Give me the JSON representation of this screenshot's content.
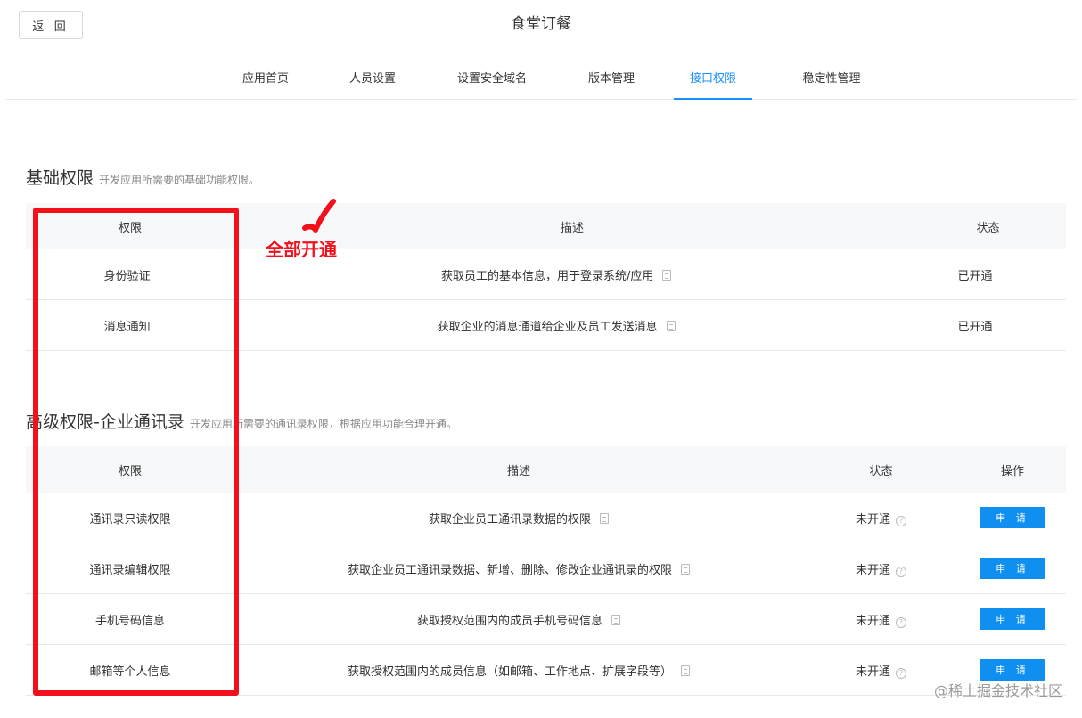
{
  "header": {
    "back_label": "返 回",
    "title": "食堂订餐"
  },
  "tabs": [
    {
      "label": "应用首页",
      "active": false
    },
    {
      "label": "人员设置",
      "active": false
    },
    {
      "label": "设置安全域名",
      "active": false
    },
    {
      "label": "版本管理",
      "active": false
    },
    {
      "label": "接口权限",
      "active": true
    },
    {
      "label": "稳定性管理",
      "active": false
    }
  ],
  "basic": {
    "title": "基础权限",
    "desc": "开发应用所需要的基础功能权限。",
    "columns": {
      "permission": "权限",
      "description": "描述",
      "status": "状态"
    },
    "rows": [
      {
        "name": "身份验证",
        "description": "获取员工的基本信息，用于登录系统/应用",
        "status": "已开通"
      },
      {
        "name": "消息通知",
        "description": "获取企业的消息通道给企业及员工发送消息",
        "status": "已开通"
      }
    ]
  },
  "advanced": {
    "title": "高级权限-企业通讯录",
    "desc": "开发应用所需要的通讯录权限，根据应用功能合理开通。",
    "columns": {
      "permission": "权限",
      "description": "描述",
      "status": "状态",
      "action": "操作"
    },
    "rows": [
      {
        "name": "通讯录只读权限",
        "description": "获取企业员工通讯录数据的权限",
        "status": "未开通",
        "action": "申 请"
      },
      {
        "name": "通讯录编辑权限",
        "description": "获取企业员工通讯录数据、新增、删除、修改企业通讯录的权限",
        "status": "未开通",
        "action": "申 请"
      },
      {
        "name": "手机号码信息",
        "description": "获取授权范围内的成员手机号码信息",
        "status": "未开通",
        "action": "申 请"
      },
      {
        "name": "邮箱等个人信息",
        "description": "获取授权范围内的成员信息（如邮箱、工作地点、扩展字段等）",
        "status": "未开通",
        "action": "申 请"
      }
    ]
  },
  "annotation": {
    "text": "全部开通",
    "color": "#f2101a"
  },
  "watermark": "@稀土掘金技术社区",
  "colors": {
    "accent": "#1890ff",
    "button": "#0f8fef",
    "highlight": "#f2101a"
  }
}
